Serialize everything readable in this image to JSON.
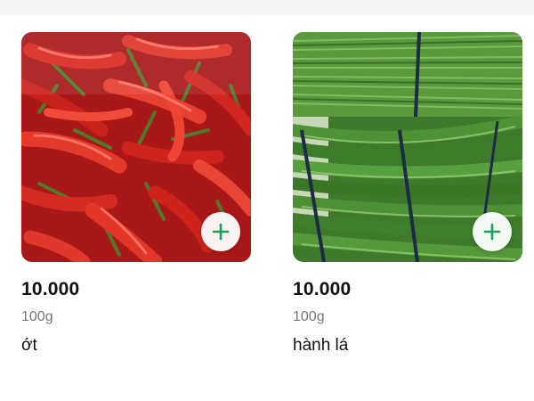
{
  "products": [
    {
      "price": "10.000",
      "unit": "100g",
      "name": "ớt",
      "image_icon": "red-chili-photo",
      "add_icon": "plus-icon"
    },
    {
      "price": "10.000",
      "unit": "100g",
      "name": "hành lá",
      "image_icon": "green-onion-photo",
      "add_icon": "plus-icon"
    }
  ],
  "colors": {
    "accent": "#1fa05a",
    "price_text": "#111111",
    "unit_text": "#777777"
  }
}
